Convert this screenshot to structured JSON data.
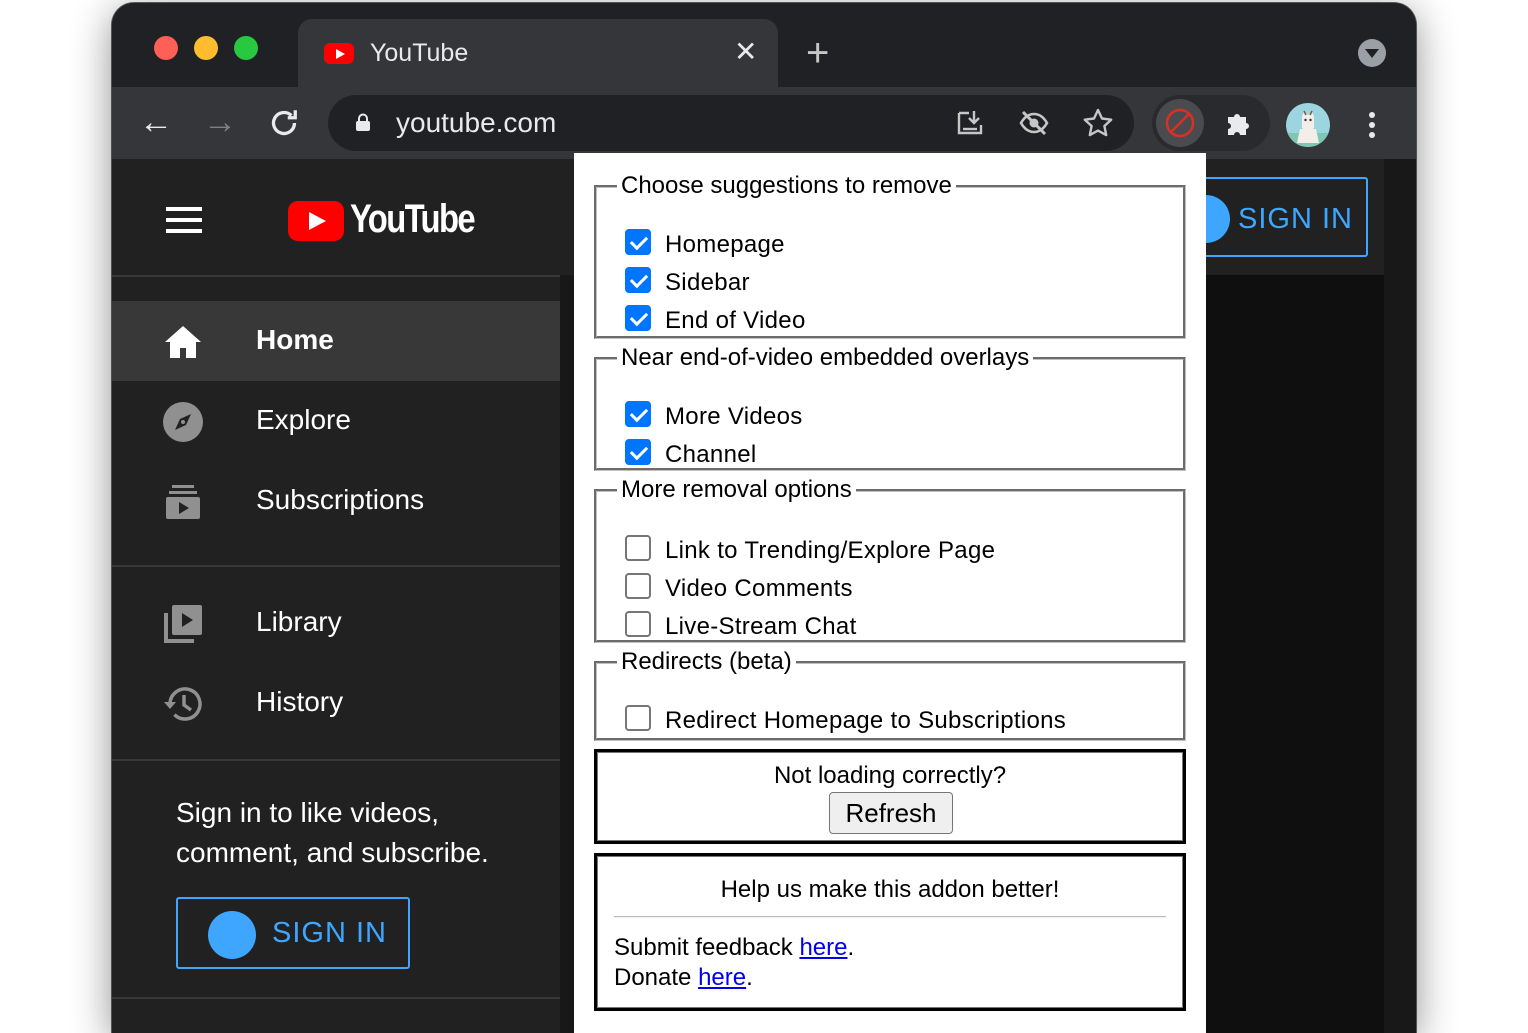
{
  "browser": {
    "tab_title": "YouTube",
    "tab_close": "✕",
    "new_tab": "+",
    "back": "←",
    "forward": "→",
    "url": "youtube.com"
  },
  "youtube": {
    "logo_text": "YouTube",
    "nav": [
      {
        "label": "Home",
        "icon": "home-icon",
        "active": true
      },
      {
        "label": "Explore",
        "icon": "compass-icon"
      },
      {
        "label": "Subscriptions",
        "icon": "subscriptions-icon"
      },
      {
        "label": "Library",
        "icon": "library-icon"
      },
      {
        "label": "History",
        "icon": "history-icon"
      }
    ],
    "signin_prompt": "Sign in to like videos, comment, and subscribe.",
    "signin_label": "SIGN IN",
    "header_signin_label": "SIGN IN",
    "accent": "#3ea6ff"
  },
  "popup": {
    "group1": {
      "legend": "Choose suggestions to remove",
      "options": [
        {
          "label": "Homepage",
          "checked": true
        },
        {
          "label": "Sidebar",
          "checked": true
        },
        {
          "label": "End of Video",
          "checked": true
        }
      ]
    },
    "group2": {
      "legend": "Near end-of-video embedded overlays",
      "options": [
        {
          "label": "More Videos",
          "checked": true
        },
        {
          "label": "Channel",
          "checked": true
        }
      ]
    },
    "group3": {
      "legend": "More removal options",
      "options": [
        {
          "label": "Link to Trending/Explore Page",
          "checked": false
        },
        {
          "label": "Video Comments",
          "checked": false
        },
        {
          "label": "Live-Stream Chat",
          "checked": false
        }
      ]
    },
    "group4": {
      "legend": "Redirects (beta)",
      "options": [
        {
          "label": "Redirect Homepage to Subscriptions",
          "checked": false
        }
      ]
    },
    "not_loading": "Not loading correctly?",
    "refresh_label": "Refresh",
    "help_title": "Help us make this addon better!",
    "feedback_prefix": "Submit feedback ",
    "feedback_link": "here",
    "feedback_suffix": ".",
    "donate_prefix": "Donate ",
    "donate_link": "here",
    "donate_suffix": "."
  }
}
